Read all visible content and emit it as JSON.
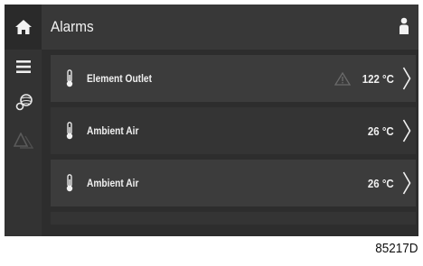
{
  "header": {
    "title": "Alarms",
    "home_icon": "home-icon",
    "user_icon": "user-icon"
  },
  "sidebar": {
    "items": [
      {
        "icon": "menu-icon"
      },
      {
        "icon": "fan-icon"
      },
      {
        "icon": "warning-icon-disabled"
      }
    ]
  },
  "alarms": [
    {
      "icon": "thermometer-icon",
      "label": "Element Outlet",
      "warning": true,
      "value": "122 °C"
    },
    {
      "icon": "thermometer-icon",
      "label": "Ambient Air",
      "warning": false,
      "value": "26 °C"
    },
    {
      "icon": "thermometer-icon",
      "label": "Ambient Air",
      "warning": false,
      "value": "26 °C"
    }
  ],
  "figure_code": "85217D",
  "colors": {
    "screen_bg": "#2d2d2d",
    "topbar_bg": "#383838",
    "row_light": "#3c3c3c",
    "row_dark": "#343434",
    "text": "#f0f0f0",
    "warning_outline": "#6a6a6a"
  }
}
